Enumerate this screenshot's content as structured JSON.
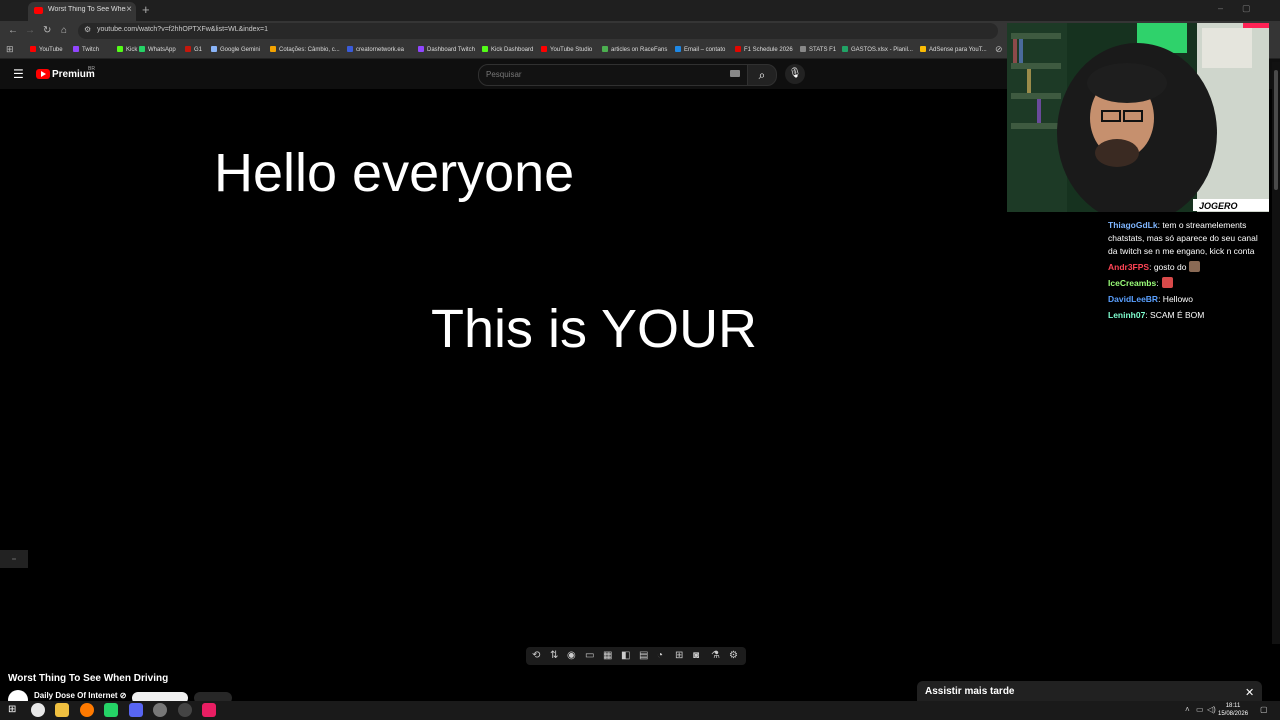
{
  "browser": {
    "tab_title": "Worst Thing To See When Driving",
    "url": "youtube.com/watch?v=f2hhOPTXFw&list=WL&index=1",
    "bookmarks": [
      {
        "label": "YouTube",
        "color": "#ff0000"
      },
      {
        "label": "Twitch",
        "color": "#9146ff"
      },
      {
        "label": "Kick",
        "color": "#53fc18"
      },
      {
        "label": "WhatsApp",
        "color": "#25d366"
      },
      {
        "label": "G1",
        "color": "#c4170c"
      },
      {
        "label": "Google Gemini",
        "color": "#8ab4f8"
      },
      {
        "label": "Cotações: Câmbio, c...",
        "color": "#f4a300"
      },
      {
        "label": "creatornetwork.ea",
        "color": "#3a5bd9"
      },
      {
        "label": "Dashboard Twitch",
        "color": "#9146ff"
      },
      {
        "label": "Kick Dashboard",
        "color": "#53fc18"
      },
      {
        "label": "YouTube Studio",
        "color": "#ff0000"
      },
      {
        "label": "articles on RaceFans",
        "color": "#4caf50"
      },
      {
        "label": "Email – contato",
        "color": "#1e88e5"
      },
      {
        "label": "F1 Schedule 2026",
        "color": "#e10600"
      },
      {
        "label": "STATS F1",
        "color": "#888888"
      },
      {
        "label": "GASTOS.xlsx - Planil...",
        "color": "#21a366"
      },
      {
        "label": "AdSense para YouT...",
        "color": "#fbbc04"
      }
    ]
  },
  "youtube": {
    "logo_text": "Premium",
    "logo_sup": "BR",
    "search_placeholder": "Pesquisar"
  },
  "video": {
    "caption_line1": "Hello everyone",
    "caption_line2": "This is YOUR",
    "title": "Worst Thing To See When Driving",
    "channel": "Daily Dose Of Internet ⊘"
  },
  "chat": [
    {
      "user": "ThiagoGdLk",
      "color": "#7fb6ff",
      "text": ": tem o streamelements chatstats, mas só aparece do seu canal da twitch se n me engano, kick n conta",
      "emote": false
    },
    {
      "user": "Andr3FPS",
      "color": "#ff4455",
      "text": ": gosto do",
      "emote": true
    },
    {
      "user": "IceCreambs",
      "color": "#9bff7a",
      "text": ":",
      "emote": true
    },
    {
      "user": "DavidLeeBR",
      "color": "#5aa0ff",
      "text": ": Hellowo",
      "emote": false
    },
    {
      "user": "Leninh07",
      "color": "#7fffd0",
      "text": ": SCAM É BOM",
      "emote": false
    }
  ],
  "overlay": {
    "watch_later": "Assistir mais tarde",
    "cam_badge": "JOGERO"
  },
  "taskbar": {
    "time": "18:11",
    "date": "15/08/2026"
  }
}
